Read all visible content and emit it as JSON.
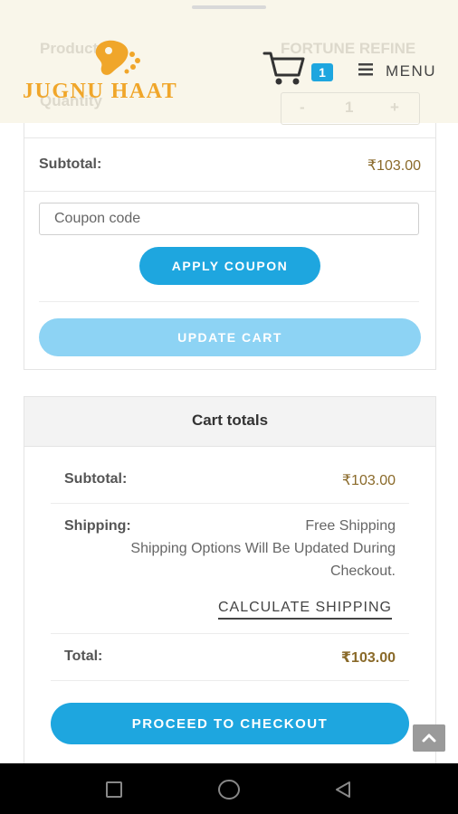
{
  "header": {
    "logo_text": "JUGNU HAAT",
    "cart_count": "1",
    "menu_label": "MENU",
    "behind_header": {
      "col_product": "Product",
      "product_name": "FORTUNE REFINE",
      "col_quantity": "Quantity",
      "qty_minus": "-",
      "qty_value": "1",
      "qty_plus": "+"
    }
  },
  "cart": {
    "subtotal_label": "Subtotal:",
    "subtotal_value": "₹103.00",
    "coupon_placeholder": "Coupon code",
    "apply_label": "APPLY COUPON",
    "update_label": "UPDATE CART"
  },
  "totals": {
    "heading": "Cart totals",
    "subtotal_label": "Subtotal:",
    "subtotal_value": "₹103.00",
    "shipping_label": "Shipping:",
    "shipping_method": "Free Shipping",
    "shipping_note_1": "Shipping Options Will Be Updated During",
    "shipping_note_2": "Checkout.",
    "calc_shipping": "CALCULATE SHIPPING",
    "total_label": "Total:",
    "total_value": "₹103.00",
    "checkout_label": "PROCEED TO CHECKOUT"
  },
  "icons": {
    "brand_color": "#f0a62a",
    "accent": "#1ea6df",
    "cart": "shopping-cart-icon",
    "menu": "hamburger-menu-icon",
    "scroll_top": "chevron-up-icon",
    "nav_recents": "square-icon",
    "nav_home": "circle-icon",
    "nav_back": "triangle-back-icon"
  }
}
